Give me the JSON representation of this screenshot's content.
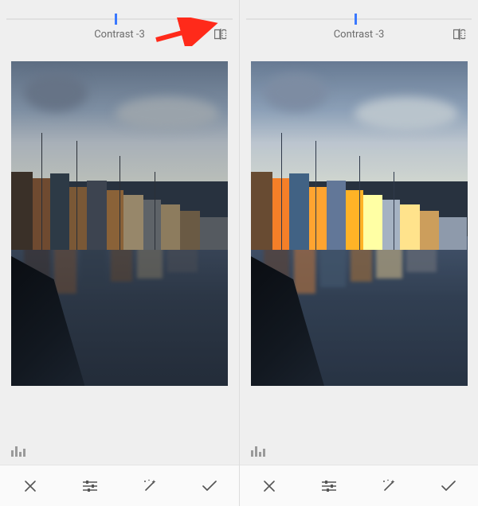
{
  "panes": {
    "left": {
      "adjustment_label": "Contrast -3",
      "slider_pos_pct": 48,
      "auto_enhanced": false
    },
    "right": {
      "adjustment_label": "Contrast -3",
      "slider_pos_pct": 48,
      "auto_enhanced": true
    }
  },
  "icons": {
    "compare": "compare-before-after-icon",
    "histogram": "histogram-icon",
    "cancel": "close-icon",
    "tune": "sliders-icon",
    "magic": "magic-wand-icon",
    "confirm": "check-icon"
  },
  "annotation": {
    "arrow_color": "#ff2a1a"
  }
}
